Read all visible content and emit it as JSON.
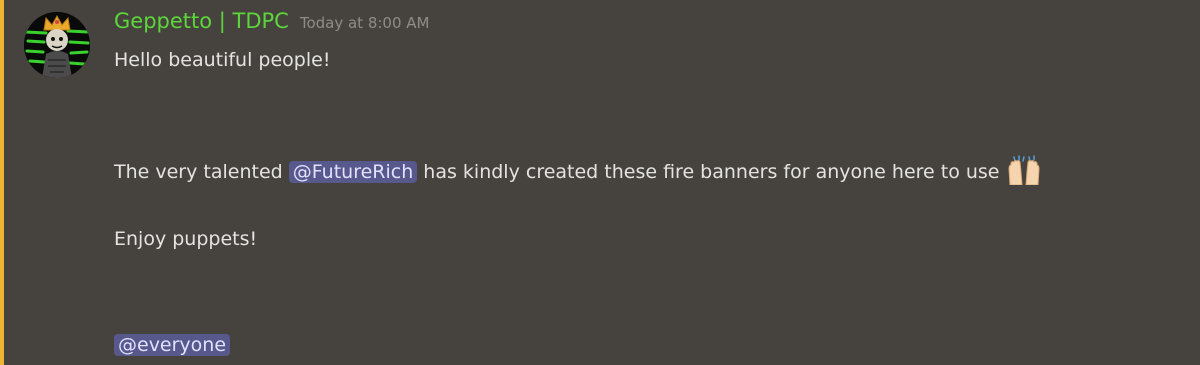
{
  "message": {
    "author": "Geppetto | TDPC",
    "timestamp": "Today at 8:00 AM",
    "avatar_icon": "crowned-puppet-avatar",
    "colors": {
      "background": "#46433e",
      "accent_bar": "#f0b232",
      "username": "#5cd63b",
      "mention_bg": "#57588c"
    },
    "lines": {
      "greeting": "Hello beautiful people!",
      "intro_before": "The very talented",
      "mention_user": "@FutureRich",
      "intro_after": "has kindly created these fire banners for anyone here to use",
      "emoji": "raised-hands-emoji",
      "closing": "Enjoy puppets!",
      "mention_everyone": "@everyone"
    }
  }
}
